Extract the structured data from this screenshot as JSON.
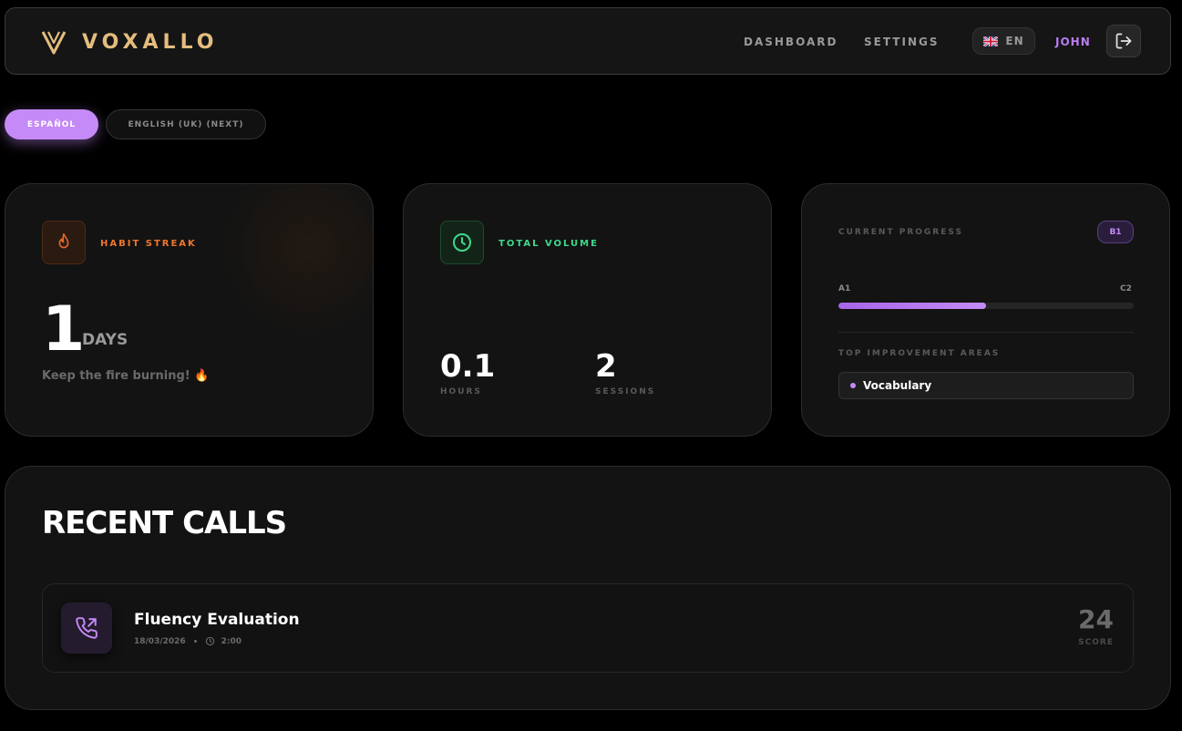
{
  "header": {
    "brand": "VOXALLO",
    "nav": [
      "DASHBOARD",
      "SETTINGS"
    ],
    "language_code": "EN",
    "language_flag_icon": "uk-flag-icon",
    "user_name": "JOHN",
    "logout_icon": "logout-icon"
  },
  "language_tabs": {
    "active": "ESPAÑOL",
    "inactive": "ENGLISH (UK) (NEXT)"
  },
  "habit_streak": {
    "label": "HABIT STREAK",
    "icon": "flame-icon",
    "value": "1",
    "unit": "DAYS",
    "message": "Keep the fire burning! 🔥"
  },
  "total_volume": {
    "label": "TOTAL VOLUME",
    "icon": "clock-icon",
    "hours_value": "0.1",
    "hours_label": "HOURS",
    "sessions_value": "2",
    "sessions_label": "SESSIONS"
  },
  "current_progress": {
    "label": "CURRENT PROGRESS",
    "level": "B1",
    "scale_min": "A1",
    "scale_max": "C2",
    "progress_fraction": 0.5,
    "areas_label": "TOP IMPROVEMENT AREAS",
    "areas": [
      "Vocabulary"
    ]
  },
  "recent_calls": {
    "title": "RECENT CALLS",
    "calls": [
      {
        "title": "Fluency Evaluation",
        "date": "18/03/2026",
        "duration": "2:00",
        "score": "24",
        "score_label": "SCORE"
      }
    ]
  },
  "colors": {
    "brand_gold": "#e4bd7e",
    "accent_purple": "#c58af7",
    "streak_orange": "#f0762c",
    "volume_green": "#3fd98a"
  }
}
